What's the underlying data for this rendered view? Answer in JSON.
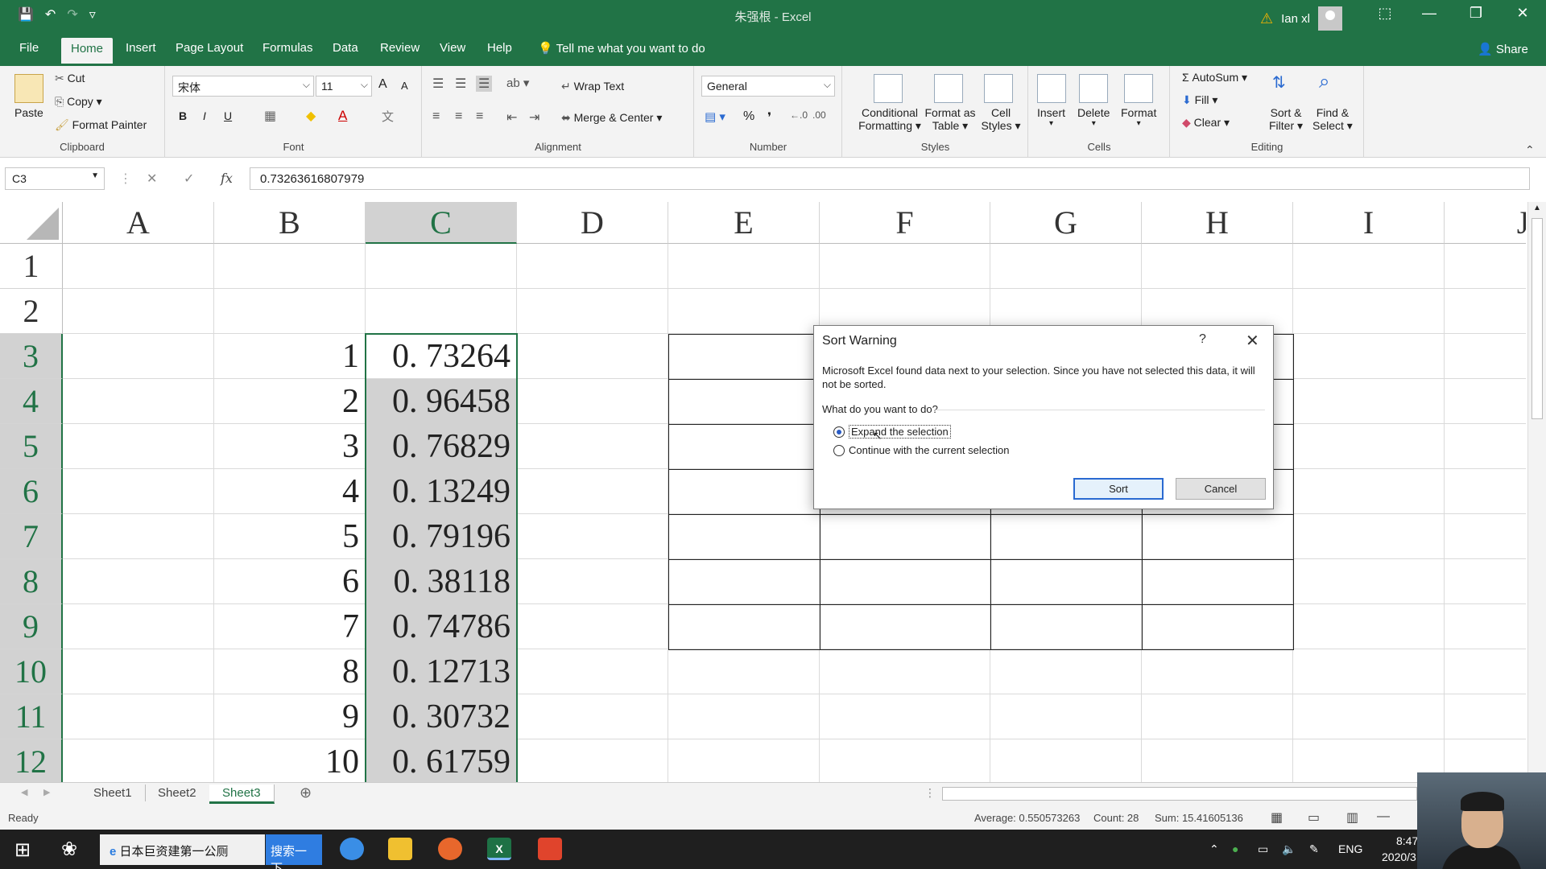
{
  "window": {
    "title": "朱强根  -  Excel",
    "user": "Ian xl",
    "minimize": "—",
    "restore": "❐",
    "close": "✕",
    "ribbon_display": "⬚"
  },
  "qat": {
    "save": "💾",
    "undo": "↶",
    "redo": "↷",
    "customize": "▿"
  },
  "tabs": [
    "File",
    "Home",
    "Insert",
    "Page Layout",
    "Formulas",
    "Data",
    "Review",
    "View",
    "Help"
  ],
  "active_tab": "Home",
  "tellme": "Tell me what you want to do",
  "share": "Share",
  "ribbon": {
    "clipboard": {
      "paste": "Paste",
      "cut": "Cut",
      "copy": "Copy",
      "format_painter": "Format Painter",
      "label": "Clipboard"
    },
    "font": {
      "name": "宋体",
      "size": "11",
      "bold": "B",
      "italic": "I",
      "underline": "U",
      "label": "Font",
      "grow": "A",
      "shrink": "A"
    },
    "alignment": {
      "wrap_text": "Wrap Text",
      "merge_center": "Merge & Center",
      "label": "Alignment"
    },
    "number": {
      "format": "General",
      "percent": "%",
      "comma": "❜",
      "label": "Number"
    },
    "styles": {
      "conditional": "Conditional",
      "conditional2": "Formatting",
      "format_as": "Format as",
      "format_as2": "Table",
      "cell": "Cell",
      "cell2": "Styles",
      "label": "Styles"
    },
    "cells": {
      "insert": "Insert",
      "delete": "Delete",
      "format": "Format",
      "label": "Cells"
    },
    "editing": {
      "autosum": "AutoSum",
      "fill": "Fill",
      "clear": "Clear",
      "sort": "Sort &",
      "sort2": "Filter",
      "find": "Find &",
      "find2": "Select",
      "label": "Editing"
    }
  },
  "formula_bar": {
    "namebox": "C3",
    "cancel": "✕",
    "enter": "✓",
    "fx": "fx",
    "value": "0.73263616807979"
  },
  "columns": [
    "A",
    "B",
    "C",
    "D",
    "E",
    "F",
    "G",
    "H",
    "I",
    "J"
  ],
  "rows": [
    "1",
    "2",
    "3",
    "4",
    "5",
    "6",
    "7",
    "8",
    "9",
    "10",
    "11",
    "12"
  ],
  "col_b": [
    "1",
    "2",
    "3",
    "4",
    "5",
    "6",
    "7",
    "8",
    "9",
    "10"
  ],
  "col_c": [
    "0. 73264",
    "0. 96458",
    "0. 76829",
    "0. 13249",
    "0. 79196",
    "0. 38118",
    "0. 74786",
    "0. 12713",
    "0. 30732",
    "0. 61759"
  ],
  "sheets": [
    "Sheet1",
    "Sheet2",
    "Sheet3"
  ],
  "active_sheet": "Sheet3",
  "add_sheet": "⊕",
  "status": {
    "ready": "Ready",
    "average": "Average: 0.550573263",
    "count": "Count: 28",
    "sum": "Sum: 15.41605136"
  },
  "taskbar": {
    "search_text": "日本巨资建第一公厕",
    "search_button": "搜索一下",
    "lang": "ENG",
    "time": "8:47",
    "date": "2020/3"
  },
  "dialog": {
    "title": "Sort Warning",
    "help": "?",
    "close": "✕",
    "message": "Microsoft Excel found data next to your selection.  Since you have not selected this data, it will not be sorted.",
    "question": "What do you want to do?",
    "option1": "Expand the selection",
    "option2": "Continue with the current selection",
    "sort": "Sort",
    "cancel": "Cancel"
  },
  "colors": {
    "excel_green": "#217346",
    "ribbon_bg": "#f3f3f3",
    "selection_gray": "#d2d2d2"
  }
}
